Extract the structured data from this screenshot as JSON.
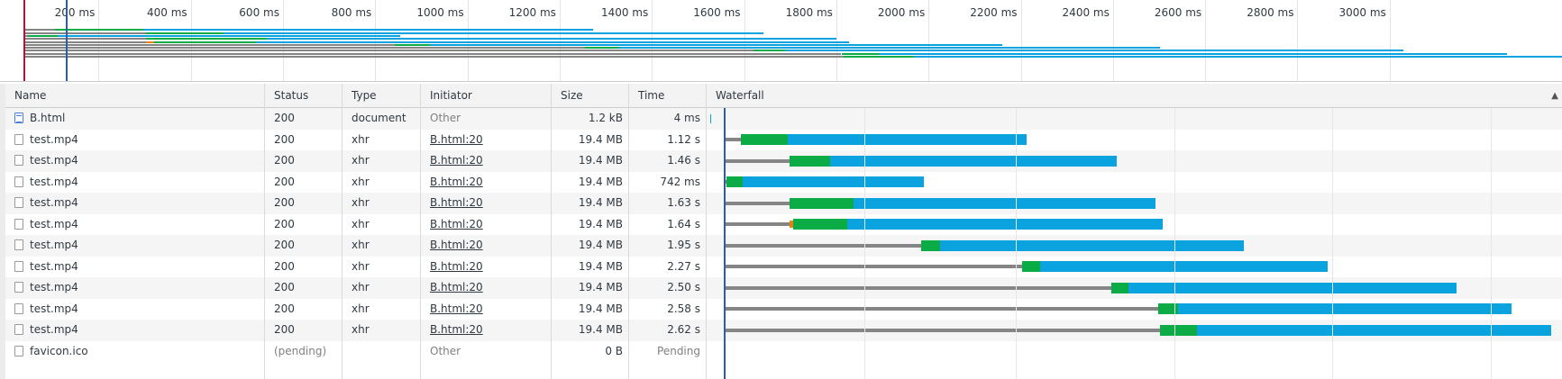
{
  "overview": {
    "ticks": [
      "200 ms",
      "400 ms",
      "600 ms",
      "800 ms",
      "1000 ms",
      "1200 ms",
      "1400 ms",
      "1600 ms",
      "1800 ms",
      "2000 ms",
      "2200 ms",
      "2400 ms",
      "2600 ms",
      "2800 ms",
      "3000 ms"
    ]
  },
  "columns": {
    "name": "Name",
    "status": "Status",
    "type": "Type",
    "initiator": "Initiator",
    "size": "Size",
    "time": "Time",
    "waterfall": "Waterfall"
  },
  "sort_indicator": "▲",
  "colors": {
    "waiting": "#858585",
    "download": "#0aa3e0",
    "ttfb": "#0bab46",
    "connect": "#e8820c"
  },
  "requests": [
    {
      "name": "B.html",
      "status": "200",
      "type": "document",
      "initiator": "Other",
      "size": "1.2 kB",
      "time": "4 ms",
      "icon": "document-icon",
      "timing_ms": {
        "start": 0,
        "queue": 0,
        "ttfb": 1,
        "download": 3
      }
    },
    {
      "name": "test.mp4",
      "status": "200",
      "type": "xhr",
      "initiator": "B.html:20",
      "size": "19.4 MB",
      "time": "1.12 s",
      "icon": "file-icon",
      "timing_ms": {
        "start": 5,
        "queue": 110,
        "ttfb": 330,
        "download": 1680
      }
    },
    {
      "name": "test.mp4",
      "status": "200",
      "type": "xhr",
      "initiator": "B.html:20",
      "size": "19.4 MB",
      "time": "1.46 s",
      "icon": "file-icon",
      "timing_ms": {
        "start": 5,
        "queue": 450,
        "ttfb": 290,
        "download": 2020
      }
    },
    {
      "name": "test.mp4",
      "status": "200",
      "type": "xhr",
      "initiator": "B.html:20",
      "size": "19.4 MB",
      "time": "742 ms",
      "icon": "file-icon",
      "timing_ms": {
        "start": 5,
        "queue": 10,
        "ttfb": 110,
        "download": 1280
      }
    },
    {
      "name": "test.mp4",
      "status": "200",
      "type": "xhr",
      "initiator": "B.html:20",
      "size": "19.4 MB",
      "time": "1.63 s",
      "icon": "file-icon",
      "timing_ms": {
        "start": 5,
        "queue": 450,
        "ttfb": 450,
        "download": 2130
      }
    },
    {
      "name": "test.mp4",
      "status": "200",
      "type": "xhr",
      "initiator": "B.html:20",
      "size": "19.4 MB",
      "time": "1.64 s",
      "icon": "file-icon",
      "timing_ms": {
        "start": 5,
        "queue": 450,
        "connect": 30,
        "ttfb": 380,
        "download": 2220
      }
    },
    {
      "name": "test.mp4",
      "status": "200",
      "type": "xhr",
      "initiator": "B.html:20",
      "size": "19.4 MB",
      "time": "1.95 s",
      "icon": "file-icon",
      "timing_ms": {
        "start": 5,
        "queue": 1380,
        "ttfb": 130,
        "download": 2140
      }
    },
    {
      "name": "test.mp4",
      "status": "200",
      "type": "xhr",
      "initiator": "B.html:20",
      "size": "19.4 MB",
      "time": "2.27 s",
      "icon": "file-icon",
      "timing_ms": {
        "start": 5,
        "queue": 2090,
        "ttfb": 130,
        "download": 2020
      }
    },
    {
      "name": "test.mp4",
      "status": "200",
      "type": "xhr",
      "initiator": "B.html:20",
      "size": "19.4 MB",
      "time": "2.50 s",
      "icon": "file-icon",
      "timing_ms": {
        "start": 5,
        "queue": 2720,
        "ttfb": 120,
        "download": 2310
      }
    },
    {
      "name": "test.mp4",
      "status": "200",
      "type": "xhr",
      "initiator": "B.html:20",
      "size": "19.4 MB",
      "time": "2.58 s",
      "icon": "file-icon",
      "timing_ms": {
        "start": 5,
        "queue": 3050,
        "ttfb": 140,
        "download": 2350
      }
    },
    {
      "name": "test.mp4",
      "status": "200",
      "type": "xhr",
      "initiator": "B.html:20",
      "size": "19.4 MB",
      "time": "2.62 s",
      "icon": "file-icon",
      "timing_ms": {
        "start": 5,
        "queue": 3060,
        "ttfb": 260,
        "download": 2500
      }
    },
    {
      "name": "favicon.ico",
      "status": "(pending)",
      "type": "",
      "initiator": "Other",
      "size": "0 B",
      "time": "Pending",
      "icon": "file-icon",
      "timing_ms": null
    }
  ]
}
